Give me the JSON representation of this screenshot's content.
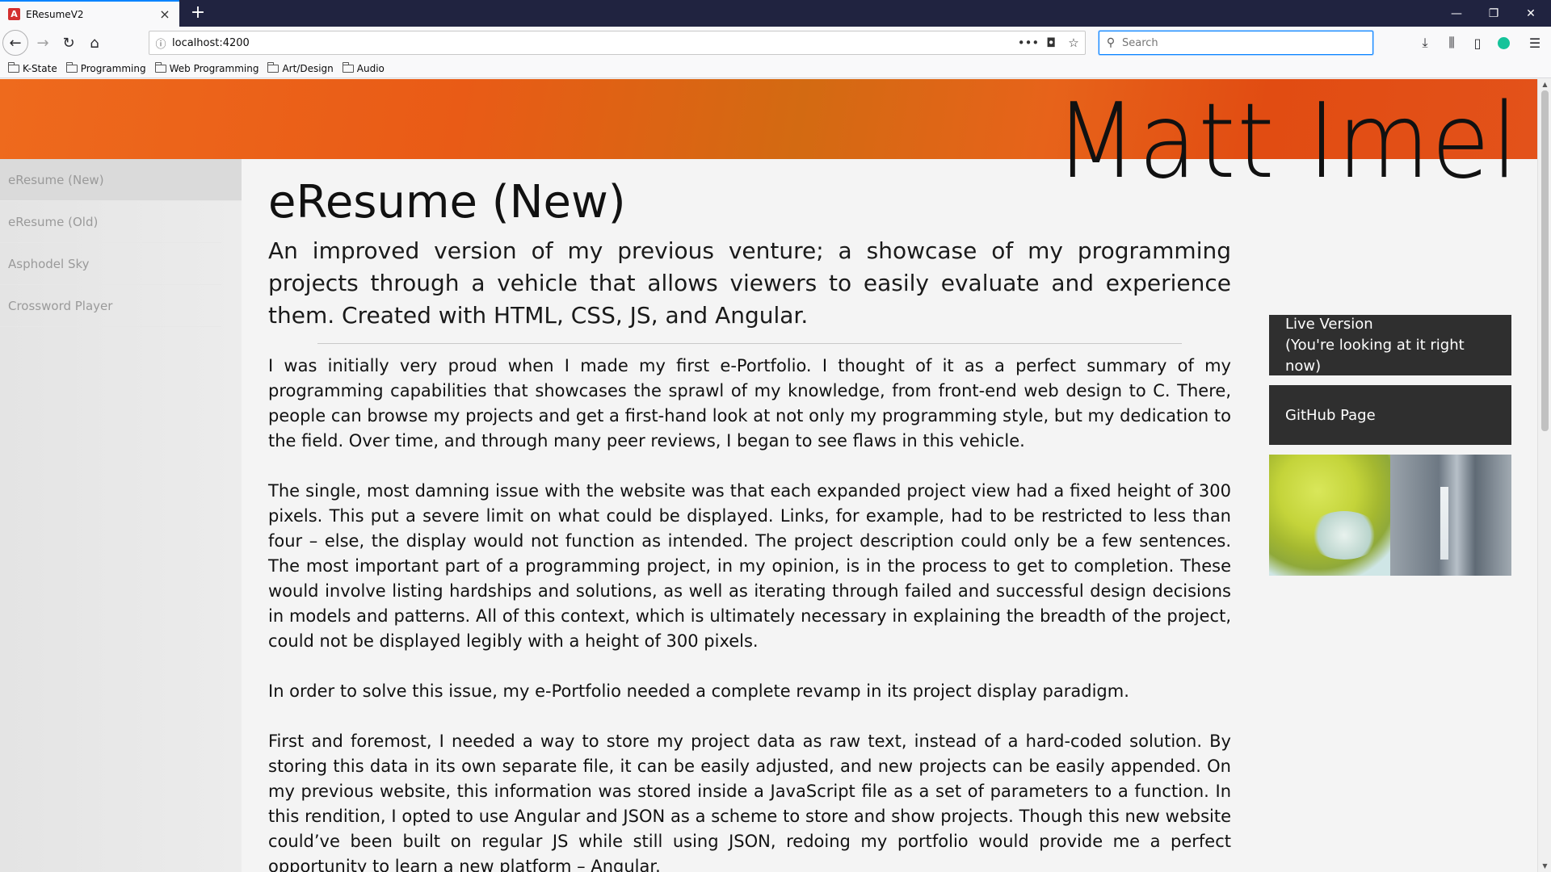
{
  "browser": {
    "tab_title": "EResumeV2",
    "tab_favicon_letter": "A",
    "url": "localhost:4200",
    "search_placeholder": "Search",
    "bookmarks": [
      "K-State",
      "Programming",
      "Web Programming",
      "Art/Design",
      "Audio"
    ]
  },
  "header": {
    "name": "Matt Imel",
    "brand_color": "#e95b16"
  },
  "sidebar": {
    "items": [
      {
        "label": "eResume (New)",
        "active": true
      },
      {
        "label": "eResume (Old)",
        "active": false
      },
      {
        "label": "Asphodel Sky",
        "active": false
      },
      {
        "label": "Crossword Player",
        "active": false
      }
    ]
  },
  "main": {
    "title": "eResume (New)",
    "subtitle": "An improved version of my previous venture; a showcase of my programming projects through a vehicle that allows viewers to easily evaluate and experience them. Created with HTML, CSS, JS, and Angular.",
    "paragraphs": [
      "I was initially very proud when I made my first e-Portfolio. I thought of it as a perfect summary of my programming capabilities that showcases the sprawl of my knowledge, from front-end web design to C. There, people can browse my projects and get a first-hand look at not only my programming style, but my dedication to the field. Over time, and through many peer reviews, I began to see flaws in this vehicle.",
      "The single, most damning issue with the website was that each expanded project view had a fixed height of 300 pixels. This put a severe limit on what could be displayed. Links, for example, had to be restricted to less than four – else, the display would not function as intended. The project description could only be a few sentences. The most important part of a programming project, in my opinion, is in the process to get to completion. These would involve listing hardships and solutions, as well as iterating through failed and successful design decisions in models and patterns. All of this context, which is ultimately necessary in explaining the breadth of the project, could not be displayed legibly with a height of 300 pixels.",
      "In order to solve this issue, my e-Portfolio needed a complete revamp in its project display paradigm.",
      "First and foremost, I needed a way to store my project data as raw text, instead of a hard-coded solution. By storing this data in its own separate file, it can be easily adjusted, and new projects can be easily appended. On my previous website, this information was stored inside a JavaScript file as a set of parameters to a function. In this rendition, I opted to use Angular and JSON as a scheme to store and show projects. Though this new website could’ve been built on regular JS while still using JSON, redoing my portfolio would provide me a perfect opportunity to learn a new platform – Angular."
    ]
  },
  "links": {
    "live_line1": "Live Version",
    "live_line2": "(You're looking at it right now)",
    "github": "GitHub Page"
  }
}
